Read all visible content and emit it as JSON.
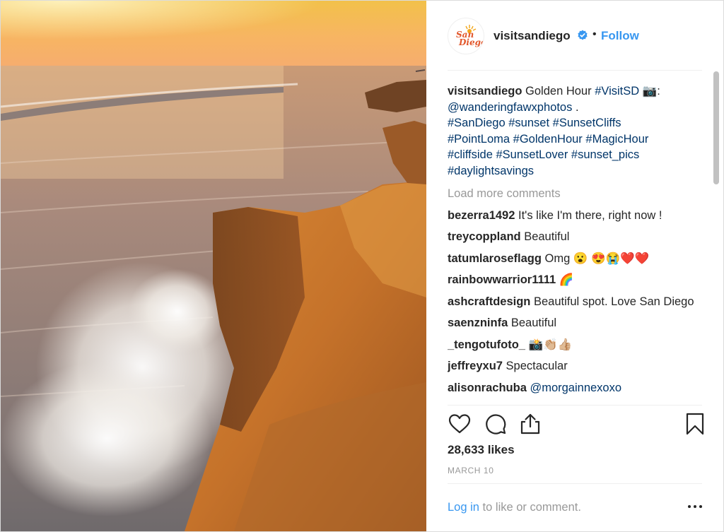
{
  "header": {
    "avatar_text_1": "San",
    "avatar_text_2": "Diego",
    "username": "visitsandiego",
    "dot": "•",
    "follow_label": "Follow"
  },
  "caption": {
    "user": "visitsandiego",
    "text_1": " Golden Hour ",
    "tag_1": "#VisitSD",
    "text_2": " 📷: ",
    "mention": "@wanderingfawxphotos",
    "text_3": " . ",
    "hashtags": [
      "#SanDiego",
      "#sunset",
      "#SunsetCliffs",
      "#PointLoma",
      "#GoldenHour",
      "#MagicHour",
      "#cliffside",
      "#SunsetLover",
      "#sunset_pics",
      "#daylightsavings"
    ]
  },
  "load_more": "Load more comments",
  "comments": [
    {
      "user": "bezerra1492",
      "text": " It's like I'm there, right now !"
    },
    {
      "user": "treycoppland",
      "text": " Beautiful"
    },
    {
      "user": "tatumlaroseflagg",
      "text": " Omg 😮 😍😭❤️❤️"
    },
    {
      "user": "rainbowwarrior1111",
      "text": " 🌈"
    },
    {
      "user": "ashcraftdesign",
      "text": " Beautiful spot. Love San Diego"
    },
    {
      "user": "saenzninfa",
      "text": " Beautiful"
    },
    {
      "user": "_tengotufoto_",
      "text": " 📸👏🏼👍🏼"
    },
    {
      "user": "jeffreyxu7",
      "text": " Spectacular"
    },
    {
      "user": "alisonrachuba",
      "text": " @morgainnexoxo"
    }
  ],
  "likes": "28,633 likes",
  "date": "MARCH 10",
  "footer": {
    "login_link": "Log in",
    "login_text": " to like or comment."
  },
  "icons": {
    "like": "heart-icon",
    "comment": "comment-bubble-icon",
    "share": "share-icon",
    "save": "bookmark-icon",
    "more": "ellipsis-icon",
    "verified": "verified-badge-icon"
  },
  "colors": {
    "link_blue": "#3897f0",
    "hashtag_blue": "#003569",
    "muted": "#999999"
  }
}
